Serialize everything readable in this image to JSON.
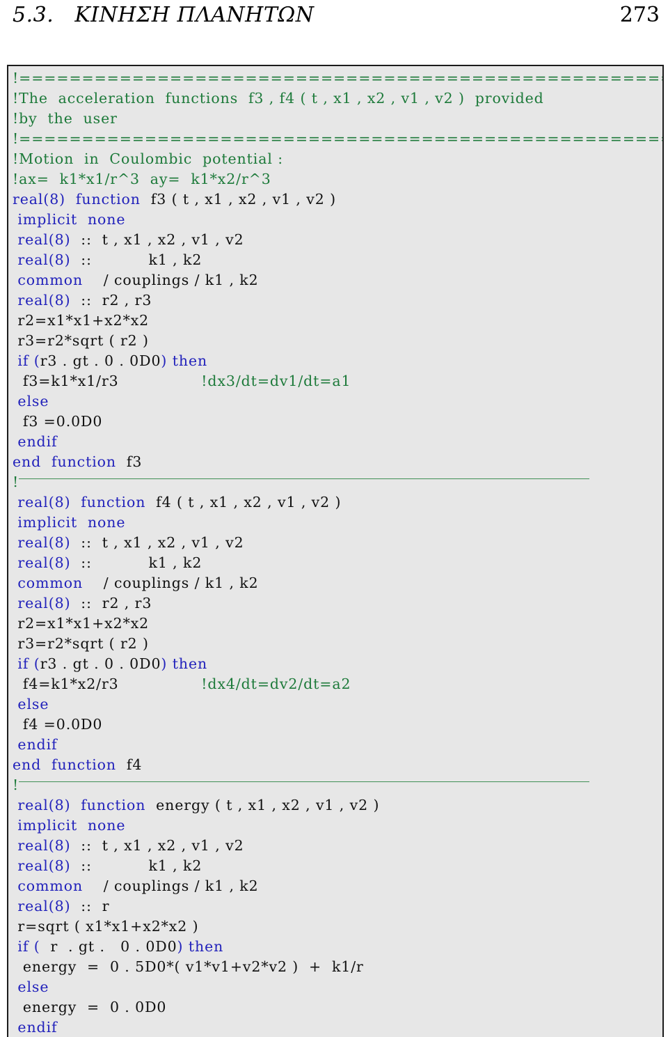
{
  "header": {
    "section": "5.3.   ΚΙΝΗΣΗ ΠΛΑΝΗΤΩΝ",
    "page_number": "273"
  },
  "colors": {
    "keyword": "#2222bb",
    "comment": "#1d7a3a",
    "identifier": "#101010",
    "listing_background": "#e7e7e7",
    "listing_border": "#1b1b1b",
    "page_background": "#ffffff"
  },
  "listing": {
    "language": "Fortran",
    "lines": [
      {
        "kind": "eqrule",
        "text": "!======================================================="
      },
      {
        "kind": "comment",
        "text": "!The  acceleration  functions  f3 , f4 ( t , x1 , x2 , v1 , v2 )  provided"
      },
      {
        "kind": "comment",
        "text": "!by  the  user"
      },
      {
        "kind": "eqrule",
        "text": "!======================================================="
      },
      {
        "kind": "comment",
        "text": "!Motion  in  Coulombic  potential :"
      },
      {
        "kind": "comment",
        "text": "!ax=  k1*x1/r^3  ay=  k1*x2/r^3"
      },
      {
        "kind": "code",
        "segments": [
          {
            "c": "kw",
            "t": "real(8)  function"
          },
          {
            "c": "id",
            "t": "  f3 ( t , x1 , x2 , v1 , v2 )"
          }
        ]
      },
      {
        "kind": "code",
        "segments": [
          {
            "c": "kw",
            "t": " implicit  none"
          }
        ]
      },
      {
        "kind": "code",
        "segments": [
          {
            "c": "kw",
            "t": " real(8)"
          },
          {
            "c": "id",
            "t": "  ::  t , x1 , x2 , v1 , v2"
          }
        ]
      },
      {
        "kind": "code",
        "segments": [
          {
            "c": "kw",
            "t": " real(8)"
          },
          {
            "c": "id",
            "t": "  ::           k1 , k2"
          }
        ]
      },
      {
        "kind": "code",
        "segments": [
          {
            "c": "kw",
            "t": " common"
          },
          {
            "c": "id",
            "t": "    / couplings / k1 , k2"
          }
        ]
      },
      {
        "kind": "code",
        "segments": [
          {
            "c": "kw",
            "t": " real(8)"
          },
          {
            "c": "id",
            "t": "  ::  r2 , r3"
          }
        ]
      },
      {
        "kind": "code",
        "segments": [
          {
            "c": "id",
            "t": " r2=x1*x1+x2*x2"
          }
        ]
      },
      {
        "kind": "code",
        "segments": [
          {
            "c": "id",
            "t": " r3=r2*sqrt ( r2 )"
          }
        ]
      },
      {
        "kind": "code",
        "segments": [
          {
            "c": "kw",
            "t": " if ("
          },
          {
            "c": "id",
            "t": "r3 . gt . 0 . 0D0"
          },
          {
            "c": "kw",
            "t": ") then"
          }
        ]
      },
      {
        "kind": "code",
        "segments": [
          {
            "c": "id",
            "t": "  f3=k1*x1/r3"
          },
          {
            "c": "id",
            "t": "                "
          },
          {
            "c": "cm",
            "t": "!dx3/dt=dv1/dt=a1"
          }
        ]
      },
      {
        "kind": "code",
        "segments": [
          {
            "c": "kw",
            "t": " else"
          }
        ]
      },
      {
        "kind": "code",
        "segments": [
          {
            "c": "id",
            "t": "  f3 =0.0D0"
          }
        ]
      },
      {
        "kind": "code",
        "segments": [
          {
            "c": "kw",
            "t": " endif"
          }
        ]
      },
      {
        "kind": "code",
        "segments": [
          {
            "c": "kw",
            "t": "end  function"
          },
          {
            "c": "id",
            "t": "  f3"
          }
        ]
      },
      {
        "kind": "rule",
        "text": "!"
      },
      {
        "kind": "code",
        "segments": [
          {
            "c": "kw",
            "t": " real(8)  function"
          },
          {
            "c": "id",
            "t": "  f4 ( t , x1 , x2 , v1 , v2 )"
          }
        ]
      },
      {
        "kind": "code",
        "segments": [
          {
            "c": "kw",
            "t": " implicit  none"
          }
        ]
      },
      {
        "kind": "code",
        "segments": [
          {
            "c": "kw",
            "t": " real(8)"
          },
          {
            "c": "id",
            "t": "  ::  t , x1 , x2 , v1 , v2"
          }
        ]
      },
      {
        "kind": "code",
        "segments": [
          {
            "c": "kw",
            "t": " real(8)"
          },
          {
            "c": "id",
            "t": "  ::           k1 , k2"
          }
        ]
      },
      {
        "kind": "code",
        "segments": [
          {
            "c": "kw",
            "t": " common"
          },
          {
            "c": "id",
            "t": "    / couplings / k1 , k2"
          }
        ]
      },
      {
        "kind": "code",
        "segments": [
          {
            "c": "kw",
            "t": " real(8)"
          },
          {
            "c": "id",
            "t": "  ::  r2 , r3"
          }
        ]
      },
      {
        "kind": "code",
        "segments": [
          {
            "c": "id",
            "t": " r2=x1*x1+x2*x2"
          }
        ]
      },
      {
        "kind": "code",
        "segments": [
          {
            "c": "id",
            "t": " r3=r2*sqrt ( r2 )"
          }
        ]
      },
      {
        "kind": "code",
        "segments": [
          {
            "c": "kw",
            "t": " if ("
          },
          {
            "c": "id",
            "t": "r3 . gt . 0 . 0D0"
          },
          {
            "c": "kw",
            "t": ") then"
          }
        ]
      },
      {
        "kind": "code",
        "segments": [
          {
            "c": "id",
            "t": "  f4=k1*x2/r3"
          },
          {
            "c": "id",
            "t": "                "
          },
          {
            "c": "cm",
            "t": "!dx4/dt=dv2/dt=a2"
          }
        ]
      },
      {
        "kind": "code",
        "segments": [
          {
            "c": "kw",
            "t": " else"
          }
        ]
      },
      {
        "kind": "code",
        "segments": [
          {
            "c": "id",
            "t": "  f4 =0.0D0"
          }
        ]
      },
      {
        "kind": "code",
        "segments": [
          {
            "c": "kw",
            "t": " endif"
          }
        ]
      },
      {
        "kind": "code",
        "segments": [
          {
            "c": "kw",
            "t": "end  function"
          },
          {
            "c": "id",
            "t": "  f4"
          }
        ]
      },
      {
        "kind": "rule",
        "text": "!"
      },
      {
        "kind": "code",
        "segments": [
          {
            "c": "kw",
            "t": " real(8)  function"
          },
          {
            "c": "id",
            "t": "  energy ( t , x1 , x2 , v1 , v2 )"
          }
        ]
      },
      {
        "kind": "code",
        "segments": [
          {
            "c": "kw",
            "t": " implicit  none"
          }
        ]
      },
      {
        "kind": "code",
        "segments": [
          {
            "c": "kw",
            "t": " real(8)"
          },
          {
            "c": "id",
            "t": "  ::  t , x1 , x2 , v1 , v2"
          }
        ]
      },
      {
        "kind": "code",
        "segments": [
          {
            "c": "kw",
            "t": " real(8)"
          },
          {
            "c": "id",
            "t": "  ::           k1 , k2"
          }
        ]
      },
      {
        "kind": "code",
        "segments": [
          {
            "c": "kw",
            "t": " common"
          },
          {
            "c": "id",
            "t": "    / couplings / k1 , k2"
          }
        ]
      },
      {
        "kind": "code",
        "segments": [
          {
            "c": "kw",
            "t": " real(8)"
          },
          {
            "c": "id",
            "t": "  ::  r"
          }
        ]
      },
      {
        "kind": "code",
        "segments": [
          {
            "c": "id",
            "t": " r=sqrt ( x1*x1+x2*x2 )"
          }
        ]
      },
      {
        "kind": "code",
        "segments": [
          {
            "c": "kw",
            "t": " if ("
          },
          {
            "c": "id",
            "t": "  r  . gt .   0 . 0D0"
          },
          {
            "c": "kw",
            "t": ") then"
          }
        ]
      },
      {
        "kind": "code",
        "segments": [
          {
            "c": "id",
            "t": "  energy  =  0 . 5D0*( v1*v1+v2*v2 )  +  k1/r"
          }
        ]
      },
      {
        "kind": "code",
        "segments": [
          {
            "c": "kw",
            "t": " else"
          }
        ]
      },
      {
        "kind": "code",
        "segments": [
          {
            "c": "id",
            "t": "  energy  =  0 . 0D0"
          }
        ]
      },
      {
        "kind": "code",
        "segments": [
          {
            "c": "kw",
            "t": " endif"
          }
        ]
      }
    ]
  }
}
